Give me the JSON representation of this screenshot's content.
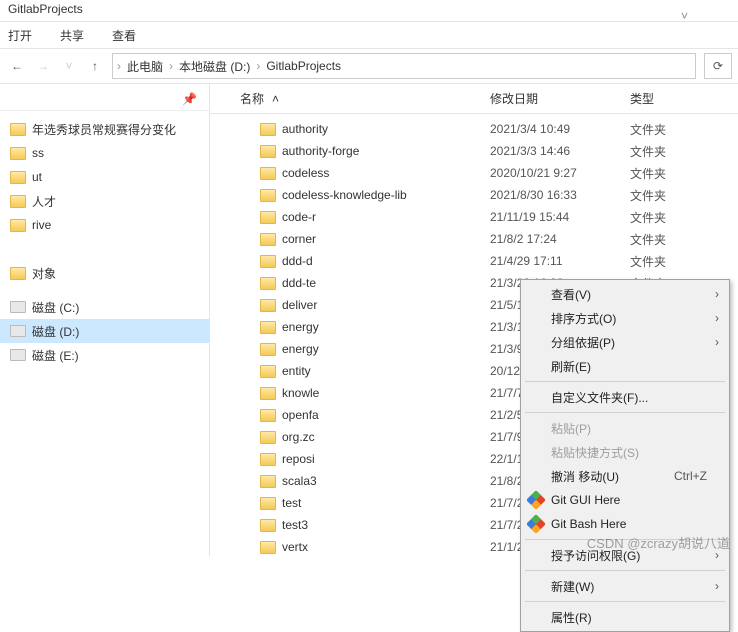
{
  "title": "GitlabProjects",
  "menu": {
    "open": "打开",
    "share": "共享",
    "view": "查看"
  },
  "breadcrumb": {
    "pc": "此电脑",
    "drive": "本地磁盘 (D:)",
    "folder": "GitlabProjects"
  },
  "sidebar": {
    "items": [
      "年选秀球员常规赛得分变化",
      "ss",
      "ut",
      "人才",
      "rive",
      "",
      "对象"
    ],
    "drives": [
      "磁盘 (C:)",
      "磁盘 (D:)",
      "磁盘 (E:)"
    ]
  },
  "columns": {
    "name": "名称",
    "date": "修改日期",
    "type": "类型"
  },
  "folderType": "文件夹",
  "files": [
    {
      "name": "authority",
      "date": "2021/3/4 10:49"
    },
    {
      "name": "authority-forge",
      "date": "2021/3/3 14:46"
    },
    {
      "name": "codeless",
      "date": "2020/10/21 9:27"
    },
    {
      "name": "codeless-knowledge-lib",
      "date": "2021/8/30 16:33"
    },
    {
      "name": "code-r",
      "date": "21/11/19 15:44"
    },
    {
      "name": "corner",
      "date": "21/8/2 17:24"
    },
    {
      "name": "ddd-d",
      "date": "21/4/29 17:11"
    },
    {
      "name": "ddd-te",
      "date": "21/3/23 16:23"
    },
    {
      "name": "deliver",
      "date": "21/5/11 9:47"
    },
    {
      "name": "energy",
      "date": "21/3/1 11:30"
    },
    {
      "name": "energy",
      "date": "21/3/9 15:19"
    },
    {
      "name": "entity",
      "date": "20/12/11 15:00"
    },
    {
      "name": "knowle",
      "date": "21/7/7 13:04"
    },
    {
      "name": "openfa",
      "date": "21/2/5 10:41"
    },
    {
      "name": "org.zc",
      "date": "21/7/9 23:08"
    },
    {
      "name": "reposi",
      "date": "22/1/10 9:45"
    },
    {
      "name": "scala3",
      "date": "21/8/2 17:18"
    },
    {
      "name": "test",
      "date": "21/7/20 13:53"
    },
    {
      "name": "test3",
      "date": "21/7/20 9:48"
    },
    {
      "name": "vertx",
      "date": "21/1/28 10:47"
    }
  ],
  "contextMenu": [
    {
      "label": "查看(V)",
      "submenu": true
    },
    {
      "label": "排序方式(O)",
      "submenu": true
    },
    {
      "label": "分组依据(P)",
      "submenu": true
    },
    {
      "label": "刷新(E)"
    },
    {
      "sep": true
    },
    {
      "label": "自定义文件夹(F)..."
    },
    {
      "sep": true
    },
    {
      "label": "粘贴(P)",
      "disabled": true
    },
    {
      "label": "粘贴快捷方式(S)",
      "disabled": true
    },
    {
      "label": "撤消 移动(U)",
      "shortcut": "Ctrl+Z"
    },
    {
      "label": "Git GUI Here",
      "icon": "git"
    },
    {
      "label": "Git Bash Here",
      "icon": "git"
    },
    {
      "sep": true
    },
    {
      "label": "授予访问权限(G)",
      "submenu": true
    },
    {
      "sep": true
    },
    {
      "label": "新建(W)",
      "submenu": true
    },
    {
      "sep": true
    },
    {
      "label": "属性(R)"
    }
  ],
  "watermark": "CSDN @zcrazy胡说八道"
}
